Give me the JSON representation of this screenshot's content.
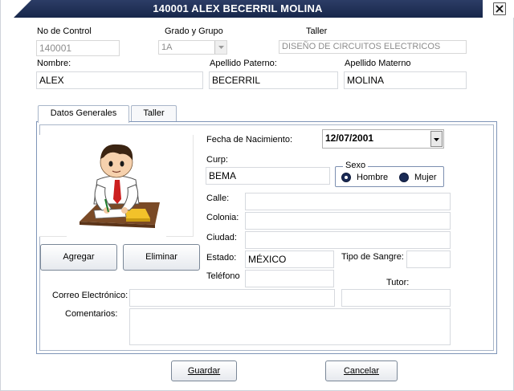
{
  "window": {
    "title": "140001 ALEX BECERRIL MOLINA",
    "close_icon": "close-icon"
  },
  "header": {
    "no_control": {
      "label": "No de Control",
      "value": "140001"
    },
    "grado_grupo": {
      "label": "Grado y Grupo",
      "value": "1A"
    },
    "taller": {
      "label": "Taller",
      "value": "DISEÑO DE CIRCUITOS ELECTRICOS"
    },
    "nombre": {
      "label": "Nombre:",
      "value": "ALEX"
    },
    "apellido_paterno": {
      "label": "Apellido Paterno:",
      "value": "BECERRIL"
    },
    "apellido_materno": {
      "label": "Apellido Materno",
      "value": "MOLINA"
    }
  },
  "tabs": [
    {
      "label": "Datos Generales",
      "active": true
    },
    {
      "label": "Taller",
      "active": false
    }
  ],
  "photo": {
    "agregar_label": "Agregar",
    "eliminar_label": "Eliminar"
  },
  "form": {
    "fecha_nacimiento": {
      "label": "Fecha de Nacimiento:",
      "value": "12/07/2001"
    },
    "curp": {
      "label": "Curp:",
      "value": "BEMA"
    },
    "sexo": {
      "label": "Sexo",
      "options": [
        "Hombre",
        "Mujer"
      ],
      "selected": "Hombre"
    },
    "calle": {
      "label": "Calle:",
      "value": ""
    },
    "colonia": {
      "label": "Colonia:",
      "value": ""
    },
    "ciudad": {
      "label": "Ciudad:",
      "value": ""
    },
    "estado": {
      "label": "Estado:",
      "value": "MÉXICO"
    },
    "tipo_sangre": {
      "label": "Tipo de Sangre:",
      "value": ""
    },
    "telefono": {
      "label": "Teléfono",
      "value": ""
    },
    "tutor": {
      "label": "Tutor:",
      "value": ""
    },
    "correo": {
      "label": "Correo Electrónico:",
      "value": ""
    },
    "comentarios": {
      "label": "Comentarios:",
      "value": ""
    }
  },
  "footer": {
    "guardar_label": "Guardar",
    "cancelar_label": "Cancelar"
  },
  "colors": {
    "title_bar": "#1f2f55",
    "panel_border": "#7f95b8",
    "radio": "#1a2a55"
  }
}
